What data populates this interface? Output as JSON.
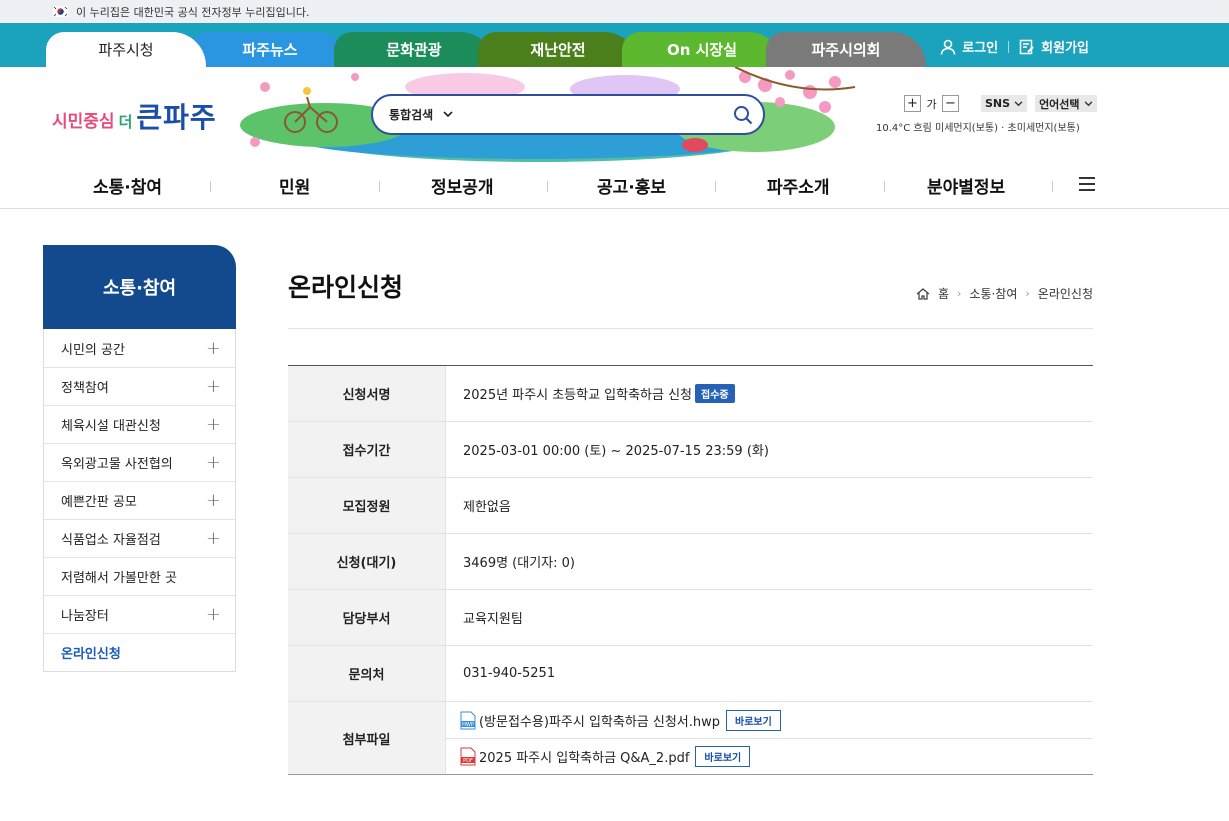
{
  "gov_banner": {
    "text": "이 누리집은 대한민국 공식 전자정부 누리집입니다."
  },
  "top_tabs": [
    {
      "label": "파주시청",
      "color": "#ffffff"
    },
    {
      "label": "파주뉴스",
      "color": "#2a95e0"
    },
    {
      "label": "문화관광",
      "color": "#1b8c5a"
    },
    {
      "label": "재난안전",
      "color": "#4a7f1c"
    },
    {
      "label": "On 시장실",
      "color": "#5cb82e"
    },
    {
      "label": "파주시의회",
      "color": "#7a7a7a"
    }
  ],
  "auth": {
    "login": "로그인",
    "signup": "회원가입"
  },
  "logo": {
    "part1": "시민중심",
    "part2": "더",
    "part3": "큰파주"
  },
  "search": {
    "category": "통합검색",
    "value": ""
  },
  "utils": {
    "zoom_in": "+",
    "zoom_label": "가",
    "zoom_out": "−",
    "sns": "SNS",
    "language": "언어선택"
  },
  "weather": "10.4°C 흐림 미세먼지(보통) · 초미세먼지(보통)",
  "gnb": [
    "소통·참여",
    "민원",
    "정보공개",
    "공고·홍보",
    "파주소개",
    "분야별정보"
  ],
  "lnb": {
    "title": "소통·참여",
    "items": [
      {
        "label": "시민의 공간",
        "plus": "+"
      },
      {
        "label": "정책참여",
        "plus": "+"
      },
      {
        "label": "체육시설 대관신청",
        "plus": "+"
      },
      {
        "label": "옥외광고물 사전협의",
        "plus": "+"
      },
      {
        "label": "예쁜간판 공모",
        "plus": "+"
      },
      {
        "label": "식품업소 자율점검",
        "plus": "+"
      },
      {
        "label": "저렴해서 가볼만한 곳",
        "plus": ""
      },
      {
        "label": "나눔장터",
        "plus": "+"
      },
      {
        "label": "온라인신청",
        "plus": ""
      }
    ]
  },
  "page": {
    "title": "온라인신청",
    "breadcrumb": [
      "홈",
      "소통·참여",
      "온라인신청"
    ]
  },
  "detail": {
    "rows": [
      {
        "label": "신청서명",
        "value": "2025년 파주시 초등학교 입학축하금 신청",
        "badge": "접수중"
      },
      {
        "label": "접수기간",
        "value": "2025-03-01 00:00 (토) ~ 2025-07-15 23:59 (화)"
      },
      {
        "label": "모집정원",
        "value": "제한없음"
      },
      {
        "label": "신청(대기)",
        "value": "3469명 (대기자: 0)"
      },
      {
        "label": "담당부서",
        "value": "교육지원팀"
      },
      {
        "label": "문의처",
        "value": "031-940-5251"
      }
    ],
    "files_label": "첨부파일",
    "files": [
      {
        "icon": "hwp-file-icon",
        "name": "(방문접수용)파주시 입학축하금 신청서.hwp",
        "button": "바로보기"
      },
      {
        "icon": "pdf-file-icon",
        "name": "2025 파주시 입학축하금 Q&A_2.pdf",
        "button": "바로보기"
      }
    ]
  }
}
